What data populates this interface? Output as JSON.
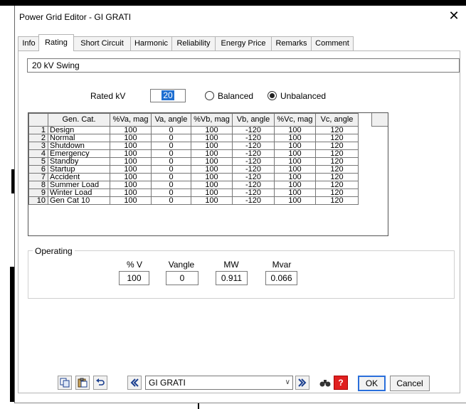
{
  "window": {
    "title": "Power Grid Editor - GI GRATI",
    "close_glyph": "✕"
  },
  "tabs": [
    "Info",
    "Rating",
    "Short Circuit",
    "Harmonic",
    "Reliability",
    "Energy Price",
    "Remarks",
    "Comment"
  ],
  "active_tab": "Rating",
  "name_box": "20 kV  Swing",
  "rated_kv": {
    "label": "Rated kV",
    "value": "20"
  },
  "mode": {
    "options": [
      "Balanced",
      "Unbalanced"
    ],
    "selected": "Unbalanced"
  },
  "table": {
    "headers": [
      "Gen. Cat.",
      "%Va, mag",
      "Va, angle",
      "%Vb, mag",
      "Vb, angle",
      "%Vc, mag",
      "Vc, angle"
    ],
    "rows": [
      {
        "num": "1",
        "cat": "Design",
        "va_mag": "100",
        "va_ang": "0",
        "vb_mag": "100",
        "vb_ang": "-120",
        "vc_mag": "100",
        "vc_ang": "120"
      },
      {
        "num": "2",
        "cat": "Normal",
        "va_mag": "100",
        "va_ang": "0",
        "vb_mag": "100",
        "vb_ang": "-120",
        "vc_mag": "100",
        "vc_ang": "120"
      },
      {
        "num": "3",
        "cat": "Shutdown",
        "va_mag": "100",
        "va_ang": "0",
        "vb_mag": "100",
        "vb_ang": "-120",
        "vc_mag": "100",
        "vc_ang": "120"
      },
      {
        "num": "4",
        "cat": "Emergency",
        "va_mag": "100",
        "va_ang": "0",
        "vb_mag": "100",
        "vb_ang": "-120",
        "vc_mag": "100",
        "vc_ang": "120"
      },
      {
        "num": "5",
        "cat": "Standby",
        "va_mag": "100",
        "va_ang": "0",
        "vb_mag": "100",
        "vb_ang": "-120",
        "vc_mag": "100",
        "vc_ang": "120"
      },
      {
        "num": "6",
        "cat": "Startup",
        "va_mag": "100",
        "va_ang": "0",
        "vb_mag": "100",
        "vb_ang": "-120",
        "vc_mag": "100",
        "vc_ang": "120"
      },
      {
        "num": "7",
        "cat": "Accident",
        "va_mag": "100",
        "va_ang": "0",
        "vb_mag": "100",
        "vb_ang": "-120",
        "vc_mag": "100",
        "vc_ang": "120"
      },
      {
        "num": "8",
        "cat": "Summer Load",
        "va_mag": "100",
        "va_ang": "0",
        "vb_mag": "100",
        "vb_ang": "-120",
        "vc_mag": "100",
        "vc_ang": "120"
      },
      {
        "num": "9",
        "cat": "Winter Load",
        "va_mag": "100",
        "va_ang": "0",
        "vb_mag": "100",
        "vb_ang": "-120",
        "vc_mag": "100",
        "vc_ang": "120"
      },
      {
        "num": "10",
        "cat": "Gen Cat 10",
        "va_mag": "100",
        "va_ang": "0",
        "vb_mag": "100",
        "vb_ang": "-120",
        "vc_mag": "100",
        "vc_ang": "120"
      }
    ]
  },
  "operating": {
    "title": "Operating",
    "labels": [
      "% V",
      "Vangle",
      "MW",
      "Mvar"
    ],
    "values": [
      "100",
      "0",
      "0.911",
      "0.066"
    ]
  },
  "bottom": {
    "combo_value": "GI GRATI",
    "ok": "OK",
    "cancel": "Cancel",
    "icons": [
      "copy-icon",
      "paste-icon",
      "undo-icon",
      "prev-icon",
      "next-icon",
      "find-icon",
      "help-icon"
    ]
  }
}
